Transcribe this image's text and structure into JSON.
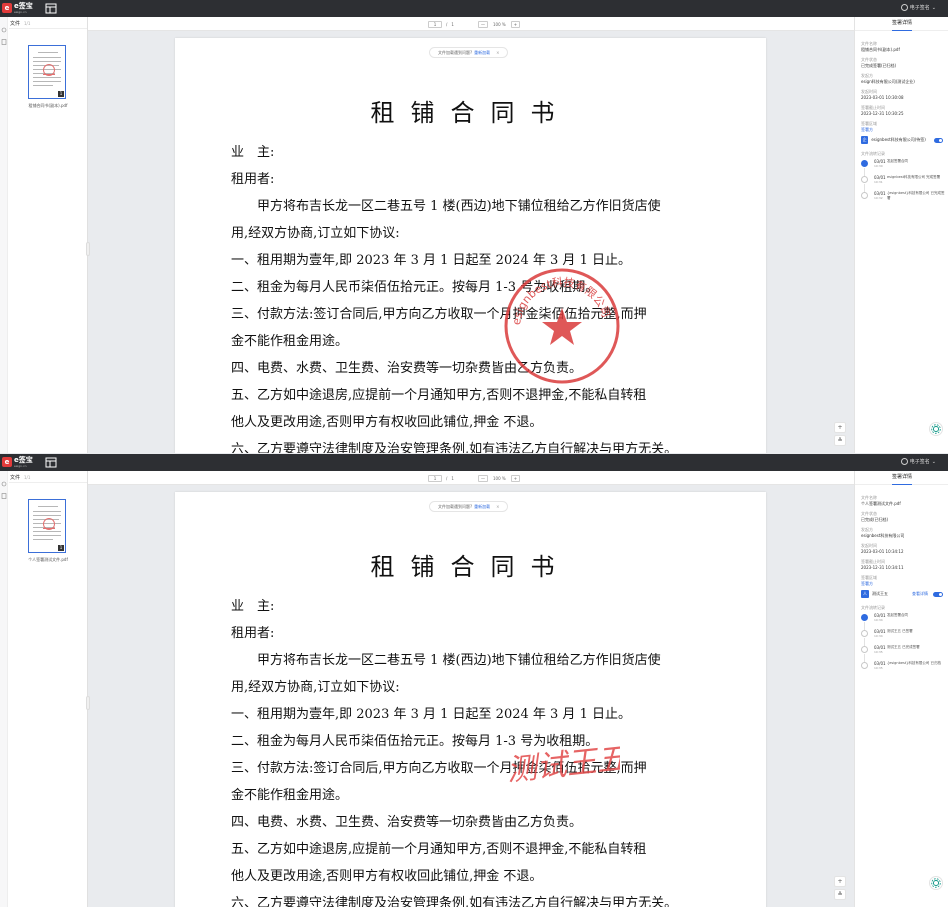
{
  "colors": {
    "topbar": "#2d2f33",
    "brand_red": "#e23b3b",
    "accent": "#2f6be0",
    "seal": "#d93b3b",
    "signature": "#e24a4a"
  },
  "panes": [
    {
      "variant": "seal",
      "topbar": {
        "brand": "e签宝",
        "brand_sub": "esign.cn",
        "user": "电子签名"
      },
      "left": {
        "tab": "文件",
        "count": "1/1",
        "file_name": "租铺合同书(副本).pdf"
      },
      "viewer": {
        "page_current": "1",
        "page_total": "1",
        "zoom": "100 %",
        "zoom_out": "—",
        "zoom_in": "+"
      },
      "tip": {
        "text": "文件加载遇到问题?",
        "link": "重新加载",
        "close": "×"
      },
      "doc": {
        "title": "租铺合同书",
        "lines": [
          "业　主:",
          "租用者:",
          "　　甲方将布吉长龙一区二巷五号 1 楼(西边)地下铺位租给乙方作旧货店使",
          "用,经双方协商,订立如下协议:",
          "一、租用期为壹年,即 2023 年 3 月 1 日起至 2024 年 3 月 1 日止。",
          "二、租金为每月人民币柒佰伍拾元正。按每月 1-3 号为收租期。",
          "三、付款方法:签订合同后,甲方向乙方收取一个月押金柒佰伍拾元整,而押",
          "金不能作租金用途。",
          "四、电费、水费、卫生费、治安费等一切杂费皆由乙方负责。",
          "五、乙方如中途退房,应提前一个月通知甲方,否则不退押金,不能私自转租",
          "他人及更改用途,否则甲方有权收回此铺位,押金 不退。",
          "六、乙方要遵守法律制度及治安管理条例,如有违法乙方自行解决与甲方无关。"
        ],
        "seal_text": "esignbest科技有限公司",
        "signature_text": ""
      },
      "right": {
        "tab": "签署详情",
        "fields": [
          {
            "label": "文件名称",
            "value": "租铺合同书(副本).pdf"
          },
          {
            "label": "文件状态",
            "value": "已完成签署(已归档)"
          },
          {
            "label": "发起方",
            "value": "esign科技有限公司(测试企业)"
          },
          {
            "label": "发起时间",
            "value": "2023-03-01 10:30:08"
          },
          {
            "label": "签署截止时间",
            "value": "2023-12-31 10:30:25"
          }
        ],
        "signer_section": "签署区域",
        "signer_group": "签署方",
        "signer_avatar": "企",
        "signer_name": "esignbest科技有限公司(待签)",
        "signer_status": "",
        "timeline_title": "文件流转记录",
        "timeline": [
          {
            "date": "03/01",
            "time": "10:30",
            "text": "发起签署合同",
            "done": true
          },
          {
            "date": "03/01",
            "time": "10:31",
            "text": "esignbest科技有限公司 完成签署",
            "done": false
          },
          {
            "date": "03/01",
            "time": "10:32",
            "text": "{esignbest}科技有限公司 已完成签署",
            "done": false
          }
        ]
      }
    },
    {
      "variant": "signature",
      "topbar": {
        "brand": "e签宝",
        "brand_sub": "esign.cn",
        "user": "电子签名"
      },
      "left": {
        "tab": "文件",
        "count": "1/1",
        "file_name": "个人签署测试文件.pdf"
      },
      "viewer": {
        "page_current": "1",
        "page_total": "1",
        "zoom": "100 %",
        "zoom_out": "—",
        "zoom_in": "+"
      },
      "tip": {
        "text": "文件加载遇到问题?",
        "link": "重新加载",
        "close": "×"
      },
      "doc": {
        "title": "租铺合同书",
        "lines": [
          "业　主:",
          "租用者:",
          "　　甲方将布吉长龙一区二巷五号 1 楼(西边)地下铺位租给乙方作旧货店使",
          "用,经双方协商,订立如下协议:",
          "一、租用期为壹年,即 2023 年 3 月 1 日起至 2024 年 3 月 1 日止。",
          "二、租金为每月人民币柒佰伍拾元正。按每月 1-3 号为收租期。",
          "三、付款方法:签订合同后,甲方向乙方收取一个月押金柒佰伍拾元整,而押",
          "金不能作租金用途。",
          "四、电费、水费、卫生费、治安费等一切杂费皆由乙方负责。",
          "五、乙方如中途退房,应提前一个月通知甲方,否则不退押金,不能私自转租",
          "他人及更改用途,否则甲方有权收回此铺位,押金 不退。",
          "六、乙方要遵守法律制度及治安管理条例,如有违法乙方自行解决与甲方无关。"
        ],
        "seal_text": "",
        "signature_text": "测试王五"
      },
      "right": {
        "tab": "签署详情",
        "fields": [
          {
            "label": "文件名称",
            "value": "个人签署测试文件.pdf"
          },
          {
            "label": "文件状态",
            "value": "已完成(已归档)"
          },
          {
            "label": "发起方",
            "value": "esignbest科技有限公司"
          },
          {
            "label": "发起时间",
            "value": "2023-03-01 10:34:12"
          },
          {
            "label": "签署截止时间",
            "value": "2023-12-31 10:34:11"
          }
        ],
        "signer_section": "签署区域",
        "signer_group": "签署方",
        "signer_avatar": "人",
        "signer_name": "测试王五",
        "signer_status": "查看详情",
        "timeline_title": "文件流转记录",
        "timeline": [
          {
            "date": "03/01",
            "time": "10:34",
            "text": "发起签署合同",
            "done": true
          },
          {
            "date": "03/01",
            "time": "10:34",
            "text": "测试王五 已签署",
            "done": false
          },
          {
            "date": "03/01",
            "time": "10:35",
            "text": "测试王五 已完成签署",
            "done": false
          },
          {
            "date": "03/01",
            "time": "10:35",
            "text": "{esignbest}科技有限公司 已归档",
            "done": false
          }
        ]
      }
    }
  ]
}
